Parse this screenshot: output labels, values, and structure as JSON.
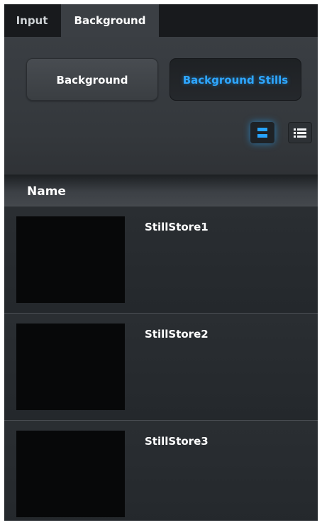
{
  "tabs": [
    {
      "label": "Input",
      "active": false
    },
    {
      "label": "Background",
      "active": true
    }
  ],
  "mode_buttons": [
    {
      "label": "Background",
      "selected": false
    },
    {
      "label": "Background Stills",
      "selected": true
    }
  ],
  "view_toggle": {
    "thumbnail_icon": "thumbnail-view-icon",
    "list_icon": "list-view-icon",
    "selected": "thumbnail"
  },
  "list": {
    "column_header": "Name",
    "items": [
      {
        "name": "StillStore1"
      },
      {
        "name": "StillStore2"
      },
      {
        "name": "StillStore3"
      }
    ]
  },
  "colors": {
    "accent": "#2ea6ff",
    "panel": "#24282c",
    "thumbnail": "#070809"
  }
}
